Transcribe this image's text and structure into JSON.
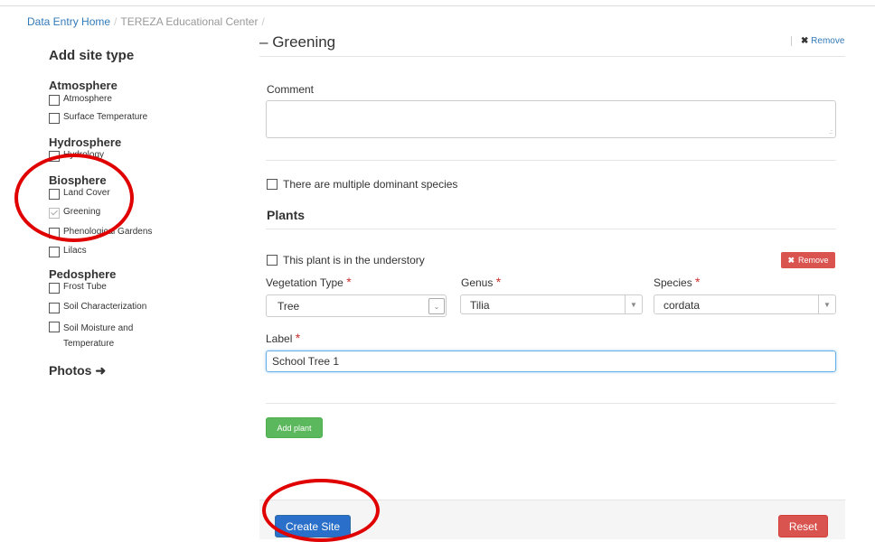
{
  "breadcrumb": {
    "home": "Data Entry Home",
    "org": "TEREZA Educational Center",
    "sep": "/"
  },
  "sidebar": {
    "title": "Add site type",
    "groups": [
      {
        "name": "Atmosphere",
        "items": [
          {
            "label": "Atmosphere",
            "checked": false
          },
          {
            "label": "Surface Temperature",
            "checked": false
          }
        ]
      },
      {
        "name": "Hydrosphere",
        "items": [
          {
            "label": "Hydrology",
            "checked": false
          }
        ]
      },
      {
        "name": "Biosphere",
        "items": [
          {
            "label": "Land Cover",
            "checked": false
          },
          {
            "label": "Greening",
            "checked": true
          },
          {
            "label": "Phenological Gardens",
            "checked": false
          },
          {
            "label": "Lilacs",
            "checked": false
          }
        ]
      },
      {
        "name": "Pedosphere",
        "items": [
          {
            "label": "Frost Tube",
            "checked": false
          },
          {
            "label": "Soil Characterization",
            "checked": false
          },
          {
            "label": "Soil Moisture and",
            "label2": "Temperature",
            "checked": false
          }
        ]
      }
    ],
    "photos": "Photos"
  },
  "section": {
    "prefix": "–",
    "title": "Greening",
    "remove": "Remove"
  },
  "comment": {
    "label": "Comment",
    "value": ""
  },
  "multi_species": {
    "label": "There are multiple dominant species",
    "checked": false
  },
  "plants": {
    "heading": "Plants",
    "understory_label": "This plant is in the understory",
    "understory_checked": false,
    "remove_label": "Remove",
    "vegetation_type": {
      "label": "Vegetation Type",
      "value": "Tree"
    },
    "genus": {
      "label": "Genus",
      "value": "Tilia"
    },
    "species": {
      "label": "Species",
      "value": "cordata"
    },
    "plant_label": {
      "label": "Label",
      "value": "School Tree 1"
    },
    "required_mark": "*",
    "add_plant": "Add plant"
  },
  "footer": {
    "create": "Create Site",
    "reset": "Reset"
  },
  "colors": {
    "link": "#337ab7",
    "primary": "#2a6fc9",
    "danger": "#d9534f",
    "success": "#5cb85c",
    "annotation_ring": "#e00000"
  }
}
